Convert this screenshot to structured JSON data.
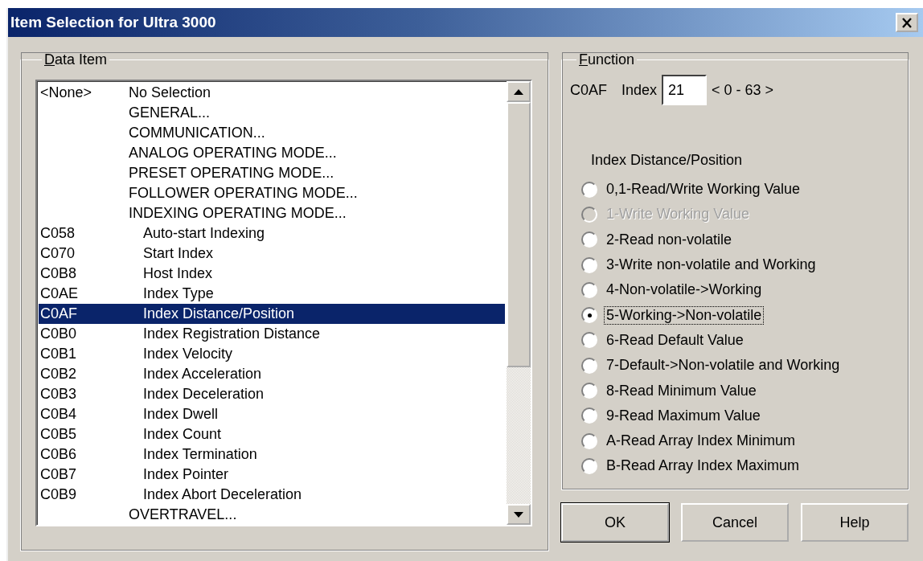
{
  "window": {
    "title": "Item Selection for Ultra 3000"
  },
  "data_item": {
    "label": "Data Item",
    "rows": [
      {
        "kind": "header",
        "code": "<None>",
        "name": "No Selection",
        "selected": false
      },
      {
        "kind": "header",
        "name": "GENERAL...",
        "selected": false
      },
      {
        "kind": "header",
        "name": "COMMUNICATION...",
        "selected": false
      },
      {
        "kind": "header",
        "name": "ANALOG OPERATING MODE...",
        "selected": false
      },
      {
        "kind": "header",
        "name": "PRESET OPERATING MODE...",
        "selected": false
      },
      {
        "kind": "header",
        "name": "FOLLOWER OPERATING MODE...",
        "selected": false
      },
      {
        "kind": "header",
        "name": "INDEXING OPERATING MODE...",
        "selected": false
      },
      {
        "kind": "parameter",
        "code": "C058",
        "name": "Auto-start Indexing",
        "selected": false
      },
      {
        "kind": "parameter",
        "code": "C070",
        "name": "Start Index",
        "selected": false
      },
      {
        "kind": "parameter",
        "code": "C0B8",
        "name": "Host Index",
        "selected": false
      },
      {
        "kind": "parameter",
        "code": "C0AE",
        "name": "Index Type",
        "selected": false
      },
      {
        "kind": "parameter",
        "code": "C0AF",
        "name": "Index Distance/Position",
        "selected": true
      },
      {
        "kind": "parameter",
        "code": "C0B0",
        "name": "Index Registration Distance",
        "selected": false
      },
      {
        "kind": "parameter",
        "code": "C0B1",
        "name": "Index Velocity",
        "selected": false
      },
      {
        "kind": "parameter",
        "code": "C0B2",
        "name": "Index Acceleration",
        "selected": false
      },
      {
        "kind": "parameter",
        "code": "C0B3",
        "name": "Index Deceleration",
        "selected": false
      },
      {
        "kind": "parameter",
        "code": "C0B4",
        "name": "Index Dwell",
        "selected": false
      },
      {
        "kind": "parameter",
        "code": "C0B5",
        "name": "Index Count",
        "selected": false
      },
      {
        "kind": "parameter",
        "code": "C0B6",
        "name": "Index Termination",
        "selected": false
      },
      {
        "kind": "parameter",
        "code": "C0B7",
        "name": "Index Pointer",
        "selected": false
      },
      {
        "kind": "parameter",
        "code": "C0B9",
        "name": "Index Abort Deceleration",
        "selected": false
      },
      {
        "kind": "header",
        "name": "OVERTRAVEL...",
        "selected": false
      }
    ]
  },
  "function": {
    "label": "Function",
    "code": "C0AF",
    "index_label": "Index",
    "index_value": "21",
    "range": "< 0 - 63 >",
    "item_name": "Index Distance/Position",
    "options": [
      {
        "label": "0,1-Read/Write Working Value",
        "selected": false,
        "disabled": false
      },
      {
        "label": "1-Write Working Value",
        "selected": false,
        "disabled": true
      },
      {
        "label": "2-Read non-volatile",
        "selected": false,
        "disabled": false
      },
      {
        "label": "3-Write non-volatile and Working",
        "selected": false,
        "disabled": false
      },
      {
        "label": "4-Non-volatile->Working",
        "selected": false,
        "disabled": false
      },
      {
        "label": "5-Working->Non-volatile",
        "selected": true,
        "disabled": false
      },
      {
        "label": "6-Read Default Value",
        "selected": false,
        "disabled": false
      },
      {
        "label": "7-Default->Non-volatile and Working",
        "selected": false,
        "disabled": false
      },
      {
        "label": "8-Read Minimum Value",
        "selected": false,
        "disabled": false
      },
      {
        "label": "9-Read Maximum Value",
        "selected": false,
        "disabled": false
      },
      {
        "label": "A-Read Array Index Minimum",
        "selected": false,
        "disabled": false
      },
      {
        "label": "B-Read Array Index Maximum",
        "selected": false,
        "disabled": false
      }
    ]
  },
  "buttons": [
    "OK",
    "Cancel",
    "Help"
  ]
}
